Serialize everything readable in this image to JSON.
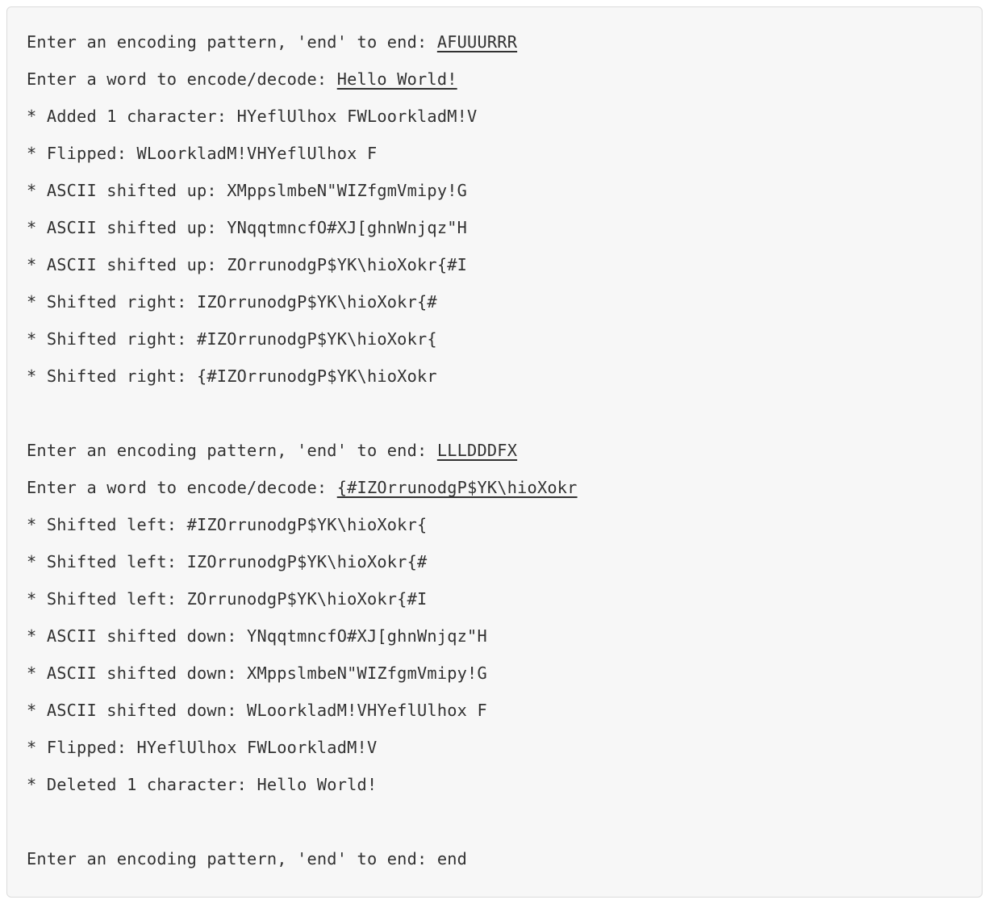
{
  "blocks": [
    {
      "prompt_pattern": "Enter an encoding pattern, 'end' to end: ",
      "pattern_input": "AFUUURRR",
      "prompt_word": "Enter a word to encode/decode: ",
      "word_input": "Hello World!",
      "steps": [
        "* Added 1 character: HYeflUlhox FWLoorkladM!V",
        "* Flipped: WLoorkladM!VHYeflUlhox F",
        "* ASCII shifted up: XMppslmbeN\"WIZfgmVmipy!G",
        "* ASCII shifted up: YNqqtmncfO#XJ[ghnWnjqz\"H",
        "* ASCII shifted up: ZOrrunodgP$YK\\hioXokr{#I",
        "* Shifted right: IZOrrunodgP$YK\\hioXokr{#",
        "* Shifted right: #IZOrrunodgP$YK\\hioXokr{",
        "* Shifted right: {#IZOrrunodgP$YK\\hioXokr"
      ]
    },
    {
      "prompt_pattern": "Enter an encoding pattern, 'end' to end: ",
      "pattern_input": "LLLDDDFX",
      "prompt_word": "Enter a word to encode/decode: ",
      "word_input": "{#IZOrrunodgP$YK\\hioXokr",
      "steps": [
        "* Shifted left: #IZOrrunodgP$YK\\hioXokr{",
        "* Shifted left: IZOrrunodgP$YK\\hioXokr{#",
        "* Shifted left: ZOrrunodgP$YK\\hioXokr{#I",
        "* ASCII shifted down: YNqqtmncfO#XJ[ghnWnjqz\"H",
        "* ASCII shifted down: XMppslmbeN\"WIZfgmVmipy!G",
        "* ASCII shifted down: WLoorkladM!VHYeflUlhox F",
        "* Flipped: HYeflUlhox FWLoorkladM!V",
        "* Deleted 1 character: Hello World!"
      ]
    }
  ],
  "final": {
    "prompt_pattern": "Enter an encoding pattern, 'end' to end: ",
    "pattern_input": "end"
  }
}
